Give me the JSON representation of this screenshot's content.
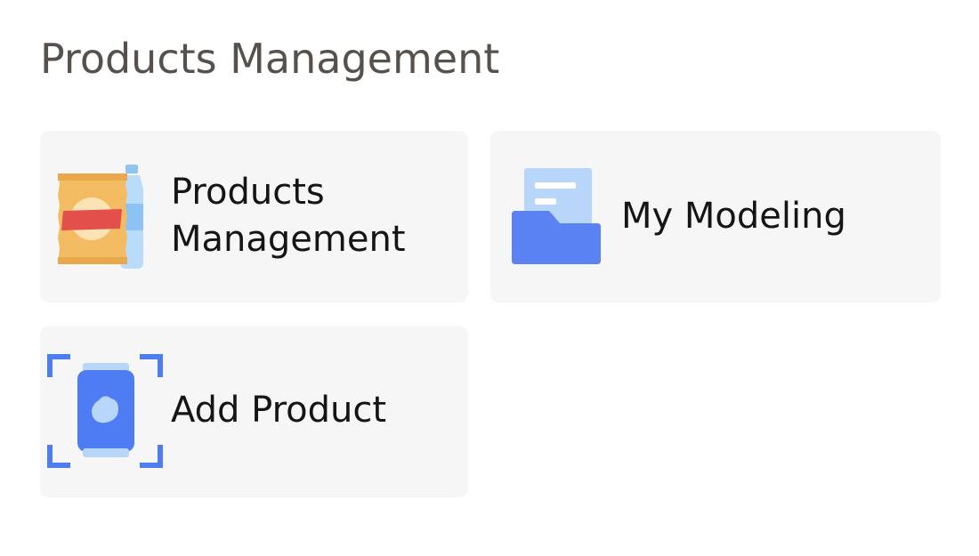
{
  "page": {
    "title": "Products Management"
  },
  "cards": {
    "products_management": {
      "label_line1": "Products",
      "label_line2": "Management",
      "icon": "snack-and-bottle-icon"
    },
    "my_modeling": {
      "label": "My Modeling",
      "icon": "folder-document-icon"
    },
    "add_product": {
      "label": "Add Product",
      "icon": "scan-can-icon"
    }
  },
  "colors": {
    "card_background": "#f6f6f6",
    "title_text": "#57514d",
    "label_text": "#151515",
    "accent_blue": "#4d7cf3",
    "light_blue": "#b7d6fa",
    "snack_orange": "#f3bc62",
    "snack_red": "#e3504b"
  }
}
